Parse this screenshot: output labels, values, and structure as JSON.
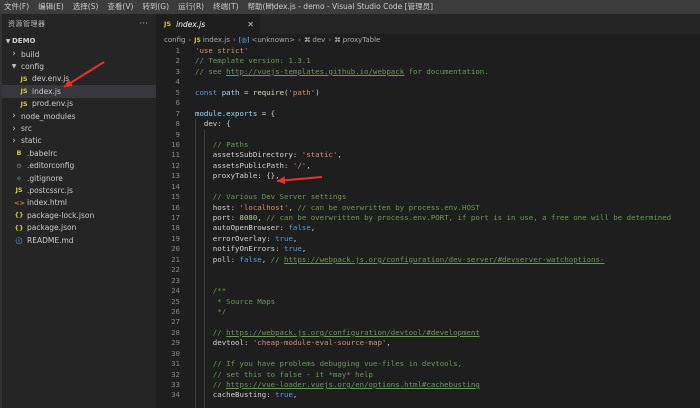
{
  "titlebar": {
    "menu": [
      "文件(F)",
      "编辑(E)",
      "选择(S)",
      "查看(V)",
      "转到(G)",
      "运行(R)",
      "终端(T)",
      "帮助(H)"
    ],
    "title": "index.js - demo - Visual Studio Code [管理员]"
  },
  "sidebar": {
    "header": "资源管理器",
    "more": "···",
    "section": "DEMO",
    "items": [
      {
        "label": "build",
        "type": "folder",
        "expanded": false,
        "depth": 0,
        "icon": "chevron-right"
      },
      {
        "label": "config",
        "type": "folder",
        "expanded": true,
        "depth": 0,
        "icon": "chevron-down"
      },
      {
        "label": "dev.env.js",
        "type": "js",
        "depth": 1,
        "icon": "JS"
      },
      {
        "label": "index.js",
        "type": "js",
        "depth": 1,
        "icon": "JS",
        "selected": true
      },
      {
        "label": "prod.env.js",
        "type": "js",
        "depth": 1,
        "icon": "JS"
      },
      {
        "label": "node_modules",
        "type": "folder",
        "expanded": false,
        "depth": 0,
        "icon": "chevron-right"
      },
      {
        "label": "src",
        "type": "folder",
        "expanded": false,
        "depth": 0,
        "icon": "chevron-right"
      },
      {
        "label": "static",
        "type": "folder",
        "expanded": false,
        "depth": 0,
        "icon": "chevron-right"
      },
      {
        "label": ".babelrc",
        "type": "babel",
        "depth": 0,
        "icon": "B"
      },
      {
        "label": ".editorconfig",
        "type": "gear",
        "depth": 0,
        "icon": "⚙"
      },
      {
        "label": ".gitignore",
        "type": "git",
        "depth": 0,
        "icon": "◆"
      },
      {
        "label": ".postcssrc.js",
        "type": "js",
        "depth": 0,
        "icon": "JS"
      },
      {
        "label": "index.html",
        "type": "html",
        "depth": 0,
        "icon": "<>"
      },
      {
        "label": "package-lock.json",
        "type": "json",
        "depth": 0,
        "icon": "{}"
      },
      {
        "label": "package.json",
        "type": "json",
        "depth": 0,
        "icon": "{}"
      },
      {
        "label": "README.md",
        "type": "md",
        "depth": 0,
        "icon": "ⓘ"
      }
    ]
  },
  "tab": {
    "icon": "JS",
    "label": "index.js",
    "close": "✕"
  },
  "breadcrumb": [
    {
      "text": "config",
      "kind": "plain"
    },
    {
      "text": "index.js",
      "kind": "js",
      "icon": "JS"
    },
    {
      "text": "<unknown>",
      "kind": "blue",
      "icon": "[◎]"
    },
    {
      "text": "dev",
      "kind": "obj",
      "icon": "⌘"
    },
    {
      "text": "proxyTable",
      "kind": "obj",
      "icon": "⌘"
    }
  ],
  "code": {
    "lines": [
      [
        [
          "str",
          "'use strict'"
        ]
      ],
      [
        [
          "cmt",
          "// Template version: 1.3.1"
        ]
      ],
      [
        [
          "cmt",
          "// see "
        ],
        [
          "link",
          "http://vuejs-templates.github.io/webpack"
        ],
        [
          "cmt",
          " for documentation."
        ]
      ],
      [],
      [
        [
          "kw",
          "const "
        ],
        [
          "var",
          "path"
        ],
        [
          "pun",
          " = "
        ],
        [
          "fn",
          "require"
        ],
        [
          "pun",
          "("
        ],
        [
          "str",
          "'path'"
        ],
        [
          "pun",
          ")"
        ]
      ],
      [],
      [
        [
          "var",
          "module"
        ],
        [
          "pun",
          "."
        ],
        [
          "var",
          "exports"
        ],
        [
          "pun",
          " = {"
        ]
      ],
      [
        [
          "pun",
          "  dev: {"
        ]
      ],
      [],
      [
        [
          "cmt",
          "    // Paths"
        ]
      ],
      [
        [
          "pun",
          "    assetsSubDirectory: "
        ],
        [
          "str",
          "'static'"
        ],
        [
          "pun",
          ","
        ]
      ],
      [
        [
          "pun",
          "    assetsPublicPath: "
        ],
        [
          "str",
          "'/'"
        ],
        [
          "pun",
          ","
        ]
      ],
      [
        [
          "pun",
          "    proxyTable: {},"
        ]
      ],
      [],
      [
        [
          "cmt",
          "    // Various Dev Server settings"
        ]
      ],
      [
        [
          "pun",
          "    host: "
        ],
        [
          "str",
          "'localhost'"
        ],
        [
          "pun",
          ", "
        ],
        [
          "cmt",
          "// can be overwritten by process.env.HOST"
        ]
      ],
      [
        [
          "pun",
          "    port: "
        ],
        [
          "num",
          "8080"
        ],
        [
          "pun",
          ", "
        ],
        [
          "cmt",
          "// can be overwritten by process.env.PORT, if port is in use, a free one will be determined"
        ]
      ],
      [
        [
          "pun",
          "    autoOpenBrowser: "
        ],
        [
          "kw",
          "false"
        ],
        [
          "pun",
          ","
        ]
      ],
      [
        [
          "pun",
          "    errorOverlay: "
        ],
        [
          "kw",
          "true"
        ],
        [
          "pun",
          ","
        ]
      ],
      [
        [
          "pun",
          "    notifyOnErrors: "
        ],
        [
          "kw",
          "true"
        ],
        [
          "pun",
          ","
        ]
      ],
      [
        [
          "pun",
          "    poll: "
        ],
        [
          "kw",
          "false"
        ],
        [
          "pun",
          ", "
        ],
        [
          "cmt",
          "// "
        ],
        [
          "link",
          "https://webpack.js.org/configuration/dev-server/#devserver-watchoptions-"
        ]
      ],
      [],
      [],
      [
        [
          "cmt",
          "    /**"
        ]
      ],
      [
        [
          "cmt",
          "     * Source Maps"
        ]
      ],
      [
        [
          "cmt",
          "     */"
        ]
      ],
      [],
      [
        [
          "cmt",
          "    // "
        ],
        [
          "link",
          "https://webpack.js.org/configuration/devtool/#development"
        ]
      ],
      [
        [
          "pun",
          "    devtool: "
        ],
        [
          "str",
          "'cheap-module-eval-source-map'"
        ],
        [
          "pun",
          ","
        ]
      ],
      [],
      [
        [
          "cmt",
          "    // If you have problems debugging vue-files in devtools,"
        ]
      ],
      [
        [
          "cmt",
          "    // set this to false - it *may* help"
        ]
      ],
      [
        [
          "cmt",
          "    // "
        ],
        [
          "link",
          "https://vue-loader.vuejs.org/en/options.html#cachebusting"
        ]
      ],
      [
        [
          "pun",
          "    cacheBusting: "
        ],
        [
          "kw",
          "true"
        ],
        [
          "pun",
          ","
        ]
      ]
    ]
  },
  "colors": {
    "annotation_arrow": "#e8322a",
    "editor_bg": "#1e1e1e",
    "sidebar_bg": "#252526"
  }
}
